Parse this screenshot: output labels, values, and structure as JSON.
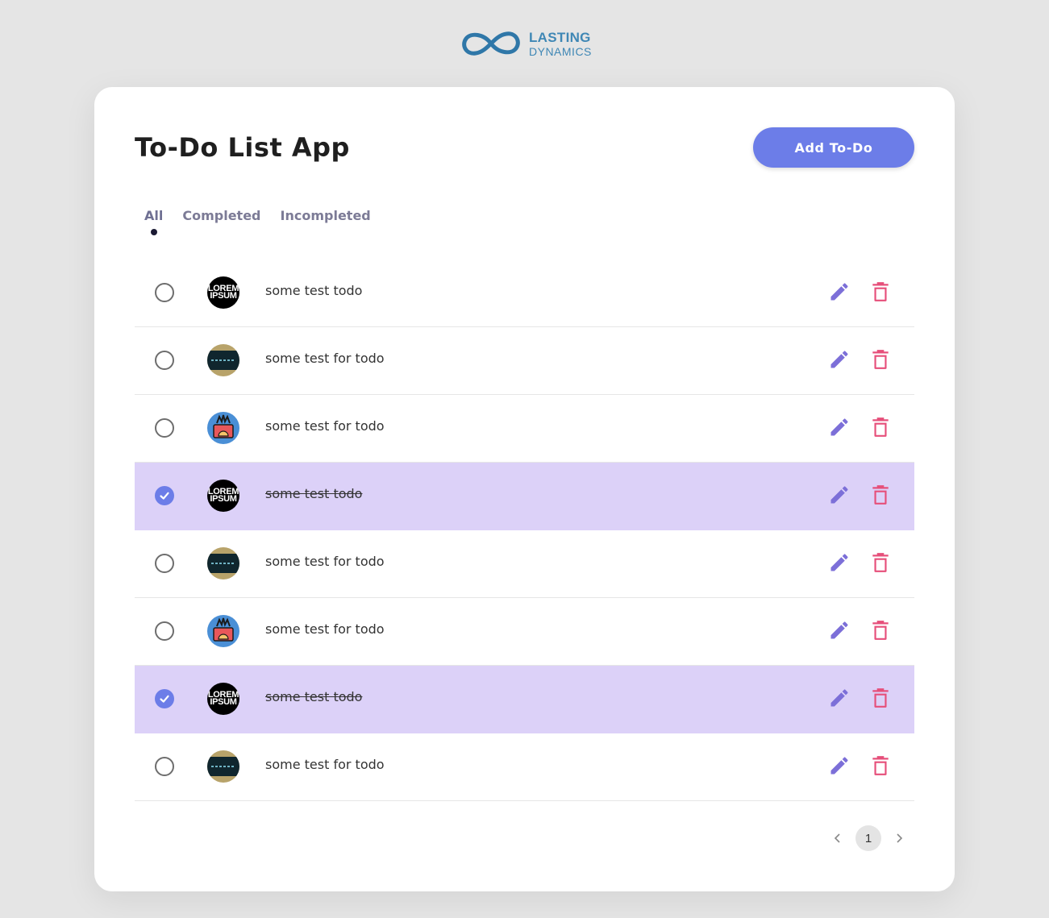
{
  "brand": {
    "line1": "LASTING",
    "line2": "DYNAMICS"
  },
  "header": {
    "title": "To-Do List App",
    "add_button": "Add To-Do"
  },
  "tabs": [
    {
      "label": "All",
      "active": true
    },
    {
      "label": "Completed",
      "active": false
    },
    {
      "label": "Incompleted",
      "active": false
    }
  ],
  "avatars": {
    "lorem_line1": "LOREM",
    "lorem_line2": "IPSUM"
  },
  "todos": [
    {
      "text": "some test todo",
      "completed": false,
      "avatar": "lorem"
    },
    {
      "text": "some test for todo",
      "completed": false,
      "avatar": "dark"
    },
    {
      "text": "some test for todo",
      "completed": false,
      "avatar": "blue"
    },
    {
      "text": "some test todo",
      "completed": true,
      "avatar": "lorem"
    },
    {
      "text": "some test for todo",
      "completed": false,
      "avatar": "dark"
    },
    {
      "text": "some test for todo",
      "completed": false,
      "avatar": "blue"
    },
    {
      "text": "some test todo",
      "completed": true,
      "avatar": "lorem"
    },
    {
      "text": "some test for todo",
      "completed": false,
      "avatar": "dark"
    }
  ],
  "pagination": {
    "current_page": "1"
  },
  "colors": {
    "accent": "#6c7de8",
    "delete": "#e64f7a",
    "completed_row": "#dcd1f8",
    "edit": "#7c6fd8"
  }
}
